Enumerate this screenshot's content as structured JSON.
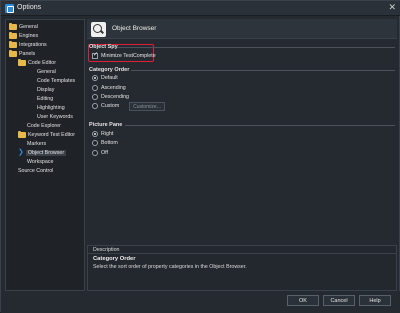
{
  "window": {
    "title": "Options",
    "close_glyph": "✕",
    "icon": "app-icon"
  },
  "tree": [
    {
      "label": "General",
      "level": 0
    },
    {
      "label": "Engines",
      "level": 0
    },
    {
      "label": "Integrations",
      "level": 0
    },
    {
      "label": "Panels",
      "level": 0
    },
    {
      "label": "Code Editor",
      "level": 1
    },
    {
      "label": "General",
      "level": 2
    },
    {
      "label": "Code Templates",
      "level": 2
    },
    {
      "label": "Display",
      "level": 2
    },
    {
      "label": "Editing",
      "level": 2
    },
    {
      "label": "Highlighting",
      "level": 2
    },
    {
      "label": "User Keywords",
      "level": 2
    },
    {
      "label": "Code Explorer",
      "level": 1
    },
    {
      "label": "Keyword Test Editor",
      "level": 1
    },
    {
      "label": "Markers",
      "level": 1
    },
    {
      "label": "Object Browser",
      "level": 1,
      "selected": true
    },
    {
      "label": "Workspace",
      "level": 1
    },
    {
      "label": "Source Control",
      "level": 0
    }
  ],
  "panel": {
    "title": "Object Browser",
    "object_spy": {
      "title": "Object Spy",
      "minimize_label": "Minimize TestComplete",
      "minimize_checked": true
    },
    "category_order": {
      "title": "Category Order",
      "options": [
        "Default",
        "Ascending",
        "Descending",
        "Custom"
      ],
      "selected": "Default",
      "customize_label": "Customize..."
    },
    "picture_pane": {
      "title": "Picture Pane",
      "options": [
        "Right",
        "Bottom",
        "Off"
      ],
      "selected": "Right"
    }
  },
  "description": {
    "header": "Description",
    "title": "Category Order",
    "text": "Select the sort order of property categories in the Object Browser."
  },
  "buttons": {
    "ok": "OK",
    "cancel": "Cancel",
    "help": "Help"
  },
  "colors": {
    "accent": "#2d8bd6",
    "highlight": "#e0203a",
    "folder": "#e7b94a"
  }
}
